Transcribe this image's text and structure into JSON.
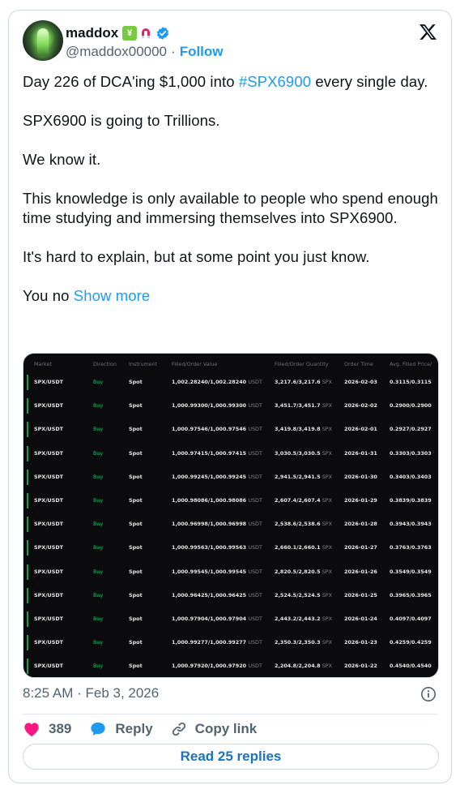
{
  "author": {
    "name": "maddox",
    "handle": "@maddox00000",
    "follow_label": "Follow",
    "badge_yen_glyph": "¥"
  },
  "tweet": {
    "line1_prefix": "Day 226 of DCA'ing $1,000 into ",
    "line1_hashtag": "#SPX6900",
    "line1_suffix": " every single day.",
    "p2": "SPX6900 is going to Trillions.",
    "p3": "We know it.",
    "p4": "This knowledge is only available to people who spend enough time studying and immersing themselves into SPX6900.",
    "p5": "It's hard to explain, but at some point you just know.",
    "p6_prefix": "You no ",
    "show_more": "Show more"
  },
  "table": {
    "headers": [
      "Market",
      "Direction",
      "Instrument",
      "Filled/Order Value",
      "Filled/Order Quantity",
      "Order Time",
      "Avg. Filled Price/"
    ],
    "value_unit": "USDT",
    "qty_unit": "SPX",
    "rows": [
      {
        "market": "SPX/USDT",
        "direction": "Buy",
        "instrument": "Spot",
        "value": "1,002.28240/1,002.28240",
        "qty": "3,217.6/3,217.6",
        "time": "2026-02-03",
        "price": "0.3115/0.3115"
      },
      {
        "market": "SPX/USDT",
        "direction": "Buy",
        "instrument": "Spot",
        "value": "1,000.99300/1,000.99300",
        "qty": "3,451.7/3,451.7",
        "time": "2026-02-02",
        "price": "0.2900/0.2900"
      },
      {
        "market": "SPX/USDT",
        "direction": "Buy",
        "instrument": "Spot",
        "value": "1,000.97546/1,000.97546",
        "qty": "3,419.8/3,419.8",
        "time": "2026-02-01",
        "price": "0.2927/0.2927"
      },
      {
        "market": "SPX/USDT",
        "direction": "Buy",
        "instrument": "Spot",
        "value": "1,000.97415/1,000.97415",
        "qty": "3,030.5/3,030.5",
        "time": "2026-01-31",
        "price": "0.3303/0.3303"
      },
      {
        "market": "SPX/USDT",
        "direction": "Buy",
        "instrument": "Spot",
        "value": "1,000.99245/1,000.99245",
        "qty": "2,941.5/2,941.5",
        "time": "2026-01-30",
        "price": "0.3403/0.3403"
      },
      {
        "market": "SPX/USDT",
        "direction": "Buy",
        "instrument": "Spot",
        "value": "1,000.98086/1,000.98086",
        "qty": "2,607.4/2,607.4",
        "time": "2026-01-29",
        "price": "0.3839/0.3839"
      },
      {
        "market": "SPX/USDT",
        "direction": "Buy",
        "instrument": "Spot",
        "value": "1,000.96998/1,000.96998",
        "qty": "2,538.6/2,538.6",
        "time": "2026-01-28",
        "price": "0.3943/0.3943"
      },
      {
        "market": "SPX/USDT",
        "direction": "Buy",
        "instrument": "Spot",
        "value": "1,000.99563/1,000.99563",
        "qty": "2,660.1/2,660.1",
        "time": "2026-01-27",
        "price": "0.3763/0.3763"
      },
      {
        "market": "SPX/USDT",
        "direction": "Buy",
        "instrument": "Spot",
        "value": "1,000.99545/1,000.99545",
        "qty": "2,820.5/2,820.5",
        "time": "2026-01-26",
        "price": "0.3549/0.3549"
      },
      {
        "market": "SPX/USDT",
        "direction": "Buy",
        "instrument": "Spot",
        "value": "1,000.96425/1,000.96425",
        "qty": "2,524.5/2,524.5",
        "time": "2026-01-25",
        "price": "0.3965/0.3965"
      },
      {
        "market": "SPX/USDT",
        "direction": "Buy",
        "instrument": "Spot",
        "value": "1,000.97904/1,000.97904",
        "qty": "2,443.2/2,443.2",
        "time": "2026-01-24",
        "price": "0.4097/0.4097"
      },
      {
        "market": "SPX/USDT",
        "direction": "Buy",
        "instrument": "Spot",
        "value": "1,000.99277/1,000.99277",
        "qty": "2,350.3/2,350.3",
        "time": "2026-01-23",
        "price": "0.4259/0.4259"
      },
      {
        "market": "SPX/USDT",
        "direction": "Buy",
        "instrument": "Spot",
        "value": "1,000.97920/1,000.97920",
        "qty": "2,204.8/2,204.8",
        "time": "2026-01-22",
        "price": "0.4540/0.4540"
      }
    ]
  },
  "footer": {
    "timestamp": "8:25 AM · Feb 3, 2026",
    "likes_count": "389",
    "reply_label": "Reply",
    "copy_link_label": "Copy link",
    "read_replies_label": "Read 25 replies"
  },
  "colors": {
    "accent": "#1d9bf0",
    "like": "#f91880",
    "buy_green": "#22c16b",
    "table_bg": "#0b0b0d"
  }
}
